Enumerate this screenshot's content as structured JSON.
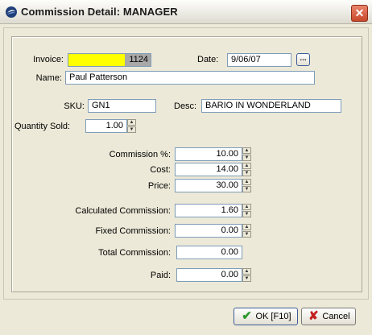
{
  "window": {
    "title": "Commission Detail: MANAGER"
  },
  "invoice": {
    "label": "Invoice:",
    "value": "1124"
  },
  "date": {
    "label": "Date:",
    "value": "9/06/07",
    "button": "..."
  },
  "name": {
    "label": "Name:",
    "value": "Paul Patterson"
  },
  "sku": {
    "label": "SKU:",
    "value": "GN1"
  },
  "desc": {
    "label": "Desc:",
    "value": "BARIO IN WONDERLAND"
  },
  "quantity": {
    "label": "Quantity Sold:",
    "value": "1.00"
  },
  "commission_pct": {
    "label": "Commission %:",
    "value": "10.00"
  },
  "cost": {
    "label": "Cost:",
    "value": "14.00"
  },
  "price": {
    "label": "Price:",
    "value": "30.00"
  },
  "calculated_commission": {
    "label": "Calculated  Commission:",
    "value": "1.60"
  },
  "fixed_commission": {
    "label": "Fixed Commission:",
    "value": "0.00"
  },
  "total_commission": {
    "label": "Total Commission:",
    "value": "0.00"
  },
  "paid": {
    "label": "Paid:",
    "value": "0.00"
  },
  "buttons": {
    "ok": "OK [F10]",
    "cancel": "Cancel"
  },
  "colors": {
    "invoice_highlight": "#ffff00",
    "invoice_number_bg": "#a8a8a8"
  }
}
